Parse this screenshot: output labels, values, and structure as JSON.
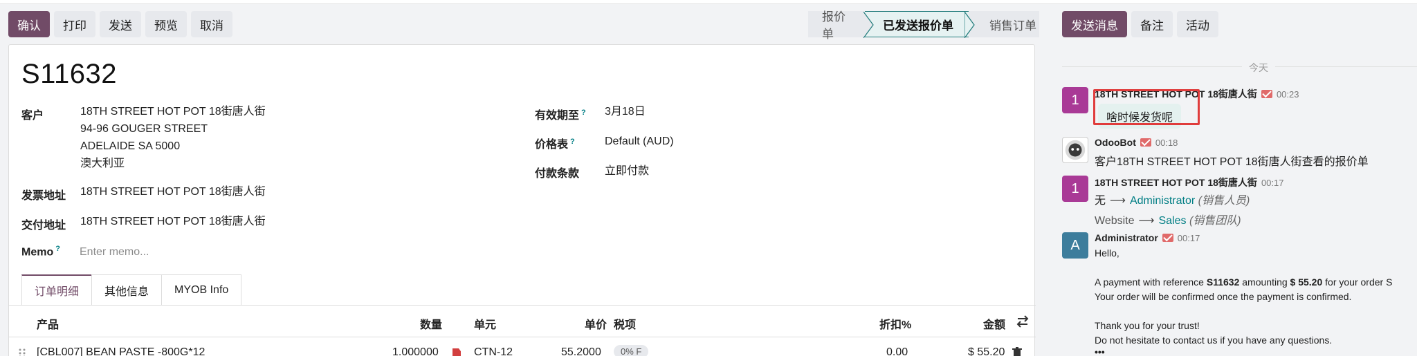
{
  "toolbar": {
    "confirm": "确认",
    "print": "打印",
    "send": "发送",
    "preview": "预览",
    "cancel": "取消"
  },
  "status": {
    "stages": [
      "报价单",
      "已发送报价单",
      "销售订单"
    ],
    "active_index": 1
  },
  "record": {
    "name": "S11632",
    "customer_label": "客户",
    "customer_lines": [
      "18TH STREET HOT POT 18街唐人街",
      "94-96 GOUGER STREET",
      "ADELAIDE SA 5000",
      "澳大利亚"
    ],
    "invoice_label": "发票地址",
    "invoice_value": "18TH STREET HOT POT 18街唐人街",
    "delivery_label": "交付地址",
    "delivery_value": "18TH STREET HOT POT 18街唐人街",
    "memo_label": "Memo",
    "memo_placeholder": "Enter memo...",
    "validity_label": "有效期至",
    "validity_value": "3月18日",
    "pricelist_label": "价格表",
    "pricelist_value": "Default (AUD)",
    "terms_label": "付款条款",
    "terms_value": "立即付款",
    "help_mark": "?"
  },
  "tabs": [
    "订单明细",
    "其他信息",
    "MYOB Info"
  ],
  "table": {
    "headers": {
      "product": "产品",
      "qty": "数量",
      "unit": "单元",
      "price": "单价",
      "tax": "税项",
      "discount": "折扣%",
      "amount": "金额"
    },
    "rows": [
      {
        "product": "[CBL007] BEAN PASTE -800G*12",
        "qty": "1.000000",
        "unit": "CTN-12",
        "price": "55.2000",
        "tax": "0% F",
        "discount": "0.00",
        "amount": "$ 55.20"
      }
    ]
  },
  "chatter": {
    "send_message": "发送消息",
    "note": "备注",
    "activity": "活动",
    "today": "今天",
    "messages": [
      {
        "avatar": "1",
        "author": "18TH STREET HOT POT 18街唐人街",
        "time": "00:23",
        "bubble": "啥时候发货呢"
      },
      {
        "author": "OdooBot",
        "time": "00:18",
        "body": "客户18TH STREET HOT POT 18街唐人街查看的报价单"
      },
      {
        "avatar": "1",
        "author": "18TH STREET HOT POT 18街唐人街",
        "time": "00:17",
        "change1_from": "无",
        "change1_to": "Administrator",
        "change1_field": "(销售人员)",
        "change2_from": "Website",
        "change2_to": "Sales",
        "change2_field": "(销售团队)"
      },
      {
        "avatar": "A",
        "author": "Administrator",
        "time": "00:17",
        "hello": "Hello,",
        "line1_a": "A payment with reference ",
        "line1_ref": "S11632",
        "line1_b": " amounting ",
        "line1_amt": "$ 55.20",
        "line1_c": " for your order S",
        "line2": "Your order will be confirmed once the payment is confirmed.",
        "line3": "Thank you for your trust!",
        "line4": "Do not hesitate to contact us if you have any questions.",
        "more": "•••"
      }
    ]
  },
  "colors": {
    "primary": "#714b67",
    "teal": "#017e84",
    "highlight_box": "#e03c3c"
  }
}
